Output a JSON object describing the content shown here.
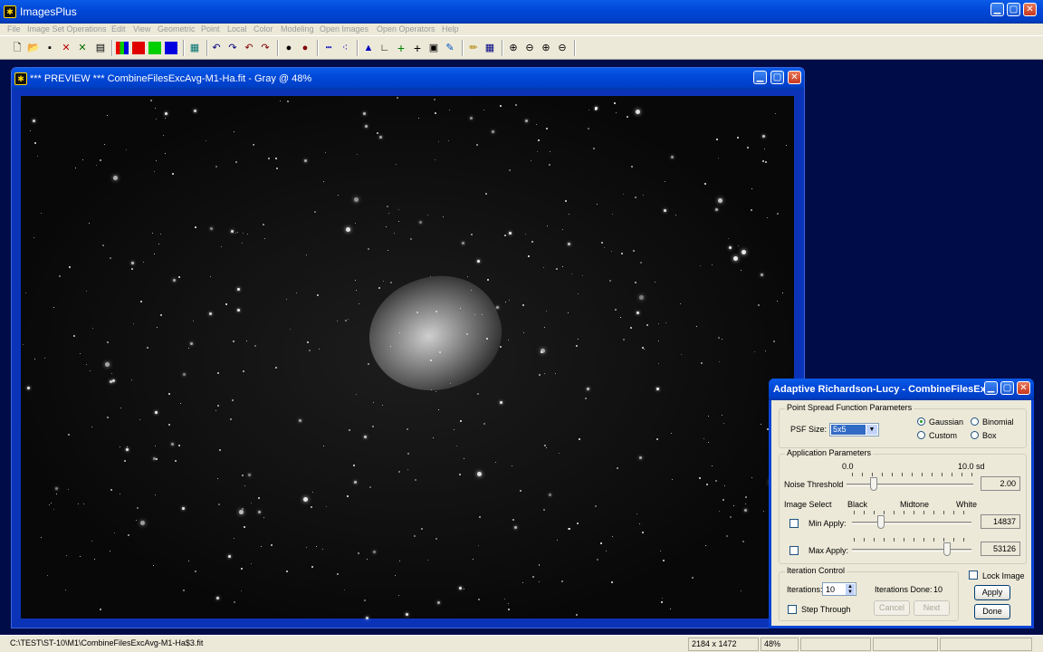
{
  "app": {
    "title": "ImagesPlus"
  },
  "menu": [
    "File",
    "Image Set Operations",
    "Edit",
    "View",
    "Geometric",
    "Point",
    "Local",
    "Color",
    "Modeling",
    "Open Images",
    "Open Operators",
    "Help"
  ],
  "toolbar_icons": [
    "new-file-icon",
    "open-folder-icon",
    "save-icon",
    "close-red-icon",
    "close-green-icon",
    "print-icon",
    "rgb-channels-icon",
    "red-channel-icon",
    "green-channel-icon",
    "blue-channel-icon",
    "grid-icon",
    "undo-icon",
    "redo-icon",
    "undo-all-icon",
    "redo-all-icon",
    "record-icon",
    "stop-record-icon",
    "dotted-line-icon",
    "star-points-icon",
    "histogram-icon",
    "curves-icon",
    "crosshair-green-icon",
    "crosshair-icon",
    "image-info-icon",
    "color-picker-icon",
    "pencil-icon",
    "table-icon",
    "zoom-in-icon",
    "zoom-out-icon",
    "zoom-fit-icon",
    "zoom-reset-icon"
  ],
  "preview": {
    "title": "*** PREVIEW *** CombineFilesExcAvg-M1-Ha.fit - Gray @ 48%"
  },
  "dialog": {
    "title": "Adaptive Richardson-Lucy - CombineFilesEx...",
    "psf": {
      "group_label": "Point Spread Function Parameters",
      "size_label": "PSF Size:",
      "size_value": "5x5",
      "options": [
        "Gaussian",
        "Binomial",
        "Custom",
        "Box"
      ],
      "selected": "Gaussian"
    },
    "app_params": {
      "group_label": "Application Parameters",
      "scale_min": "0.0",
      "scale_max": "10.0 sd",
      "noise_label": "Noise Threshold",
      "noise_value": "2.00",
      "noise_level": 0.2,
      "image_select_label": "Image Select",
      "black_label": "Black",
      "midtone_label": "Midtone",
      "white_label": "White",
      "min_label": "Min Apply:",
      "min_value": "14837",
      "min_level": 0.226,
      "max_label": "Max Apply:",
      "max_value": "53126",
      "max_level": 0.811
    },
    "iteration": {
      "group_label": "Iteration Control",
      "iterations_label": "Iterations:",
      "iterations_value": "10",
      "done_label": "Iterations Done:",
      "done_value": "10",
      "step_label": "Step Through",
      "cancel_label": "Cancel",
      "next_label": "Next"
    },
    "lock_label": "Lock Image",
    "apply_label": "Apply",
    "done_label": "Done"
  },
  "status": {
    "path": "C:\\TEST\\ST-10\\M1\\CombineFilesExcAvg-M1-Ha$3.fit",
    "dims": "2184 x 1472",
    "zoom": "48%"
  },
  "colors": {
    "desktop": "#000C48",
    "titlebar": "#0047D7",
    "frame": "#0A33B8",
    "panel": "#ECE9D8"
  }
}
